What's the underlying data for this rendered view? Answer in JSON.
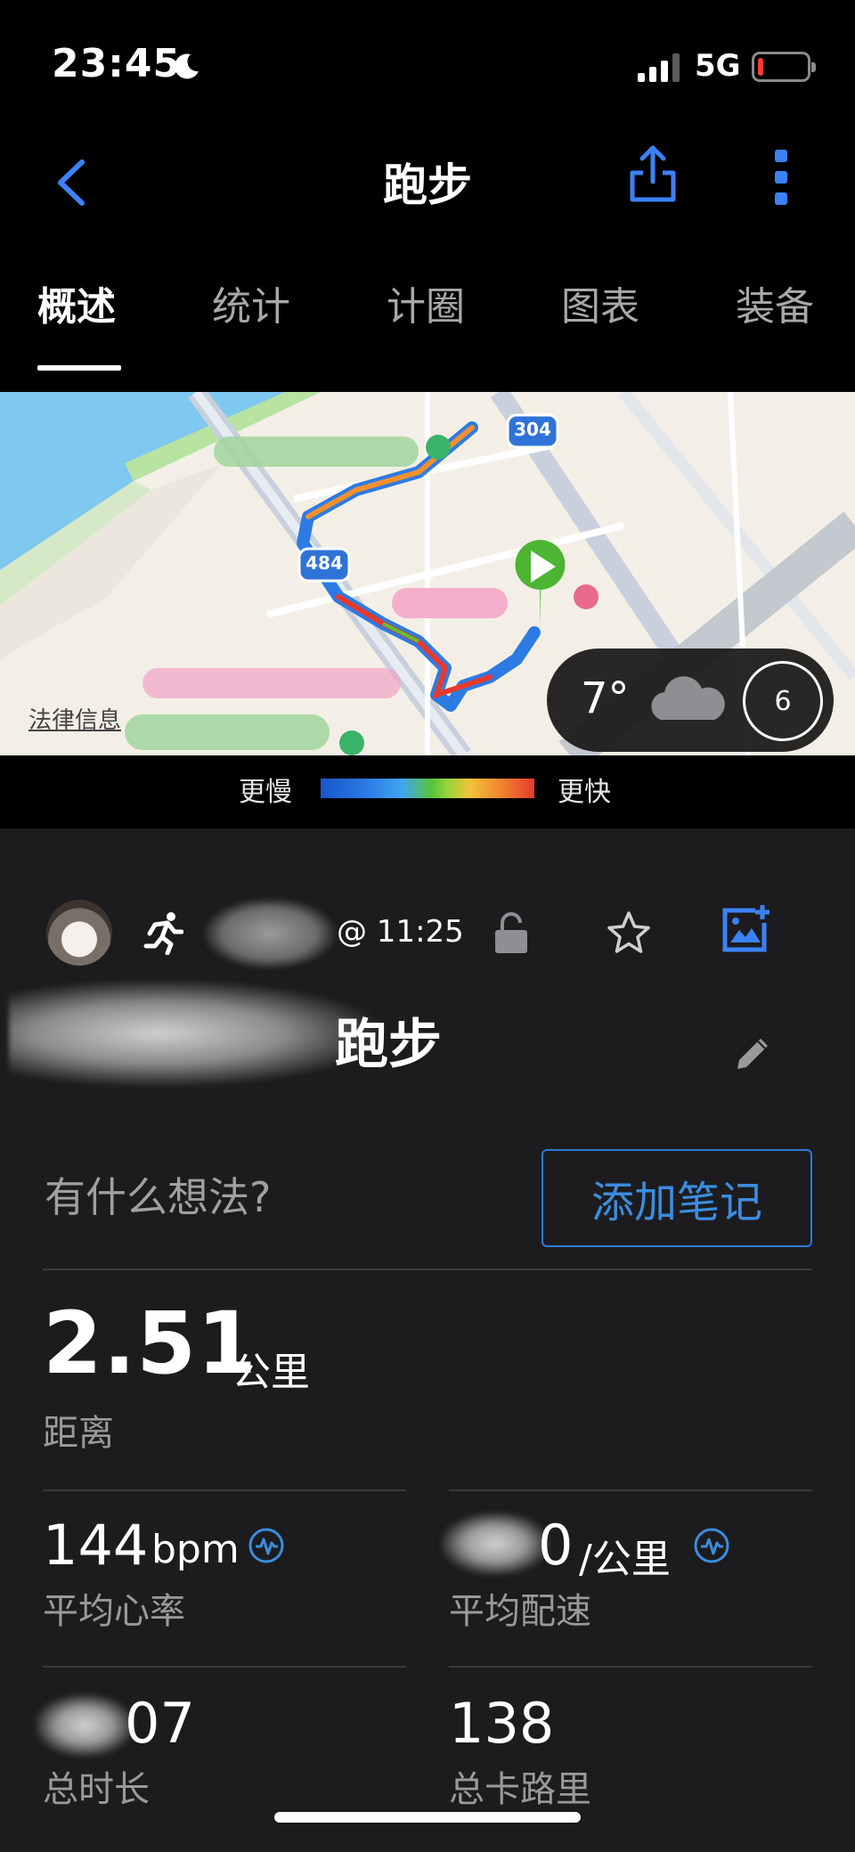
{
  "status_bar": {
    "time": "23:45",
    "network": "5G",
    "battery_level": 0.1
  },
  "navbar": {
    "title": "跑步",
    "icons": [
      "back-chevron-icon",
      "share-icon",
      "more-vertical-icon"
    ]
  },
  "tabs": [
    {
      "label": "概述",
      "active": true
    },
    {
      "label": "统计",
      "active": false
    },
    {
      "label": "计圈",
      "active": false
    },
    {
      "label": "图表",
      "active": false
    },
    {
      "label": "装备",
      "active": false
    }
  ],
  "map": {
    "route_shields": [
      "304",
      "484"
    ],
    "legal_link": "法律信息",
    "weather": {
      "temperature": "7°",
      "icon": "cloud-icon",
      "dial_value": "6"
    }
  },
  "pace_legend": {
    "slower": "更慢",
    "faster": "更快"
  },
  "activity": {
    "time": "@ 11:25",
    "title": "跑步",
    "prompt": "有什么想法?",
    "add_note_label": "添加笔记"
  },
  "metrics": {
    "distance": {
      "value": "2.51",
      "unit": "公里",
      "label": "距离"
    },
    "heart_rate": {
      "value": "144",
      "unit": "bpm",
      "label": "平均心率"
    },
    "pace": {
      "value": "0",
      "unit": "/公里",
      "label": "平均配速"
    },
    "duration": {
      "value": "07",
      "label": "总时长"
    },
    "calories": {
      "value": "138",
      "label": "总卡路里"
    }
  },
  "colors": {
    "accent": "#3b8de0",
    "panel_bg": "#1c1c1e",
    "screen_bg": "#000000"
  }
}
